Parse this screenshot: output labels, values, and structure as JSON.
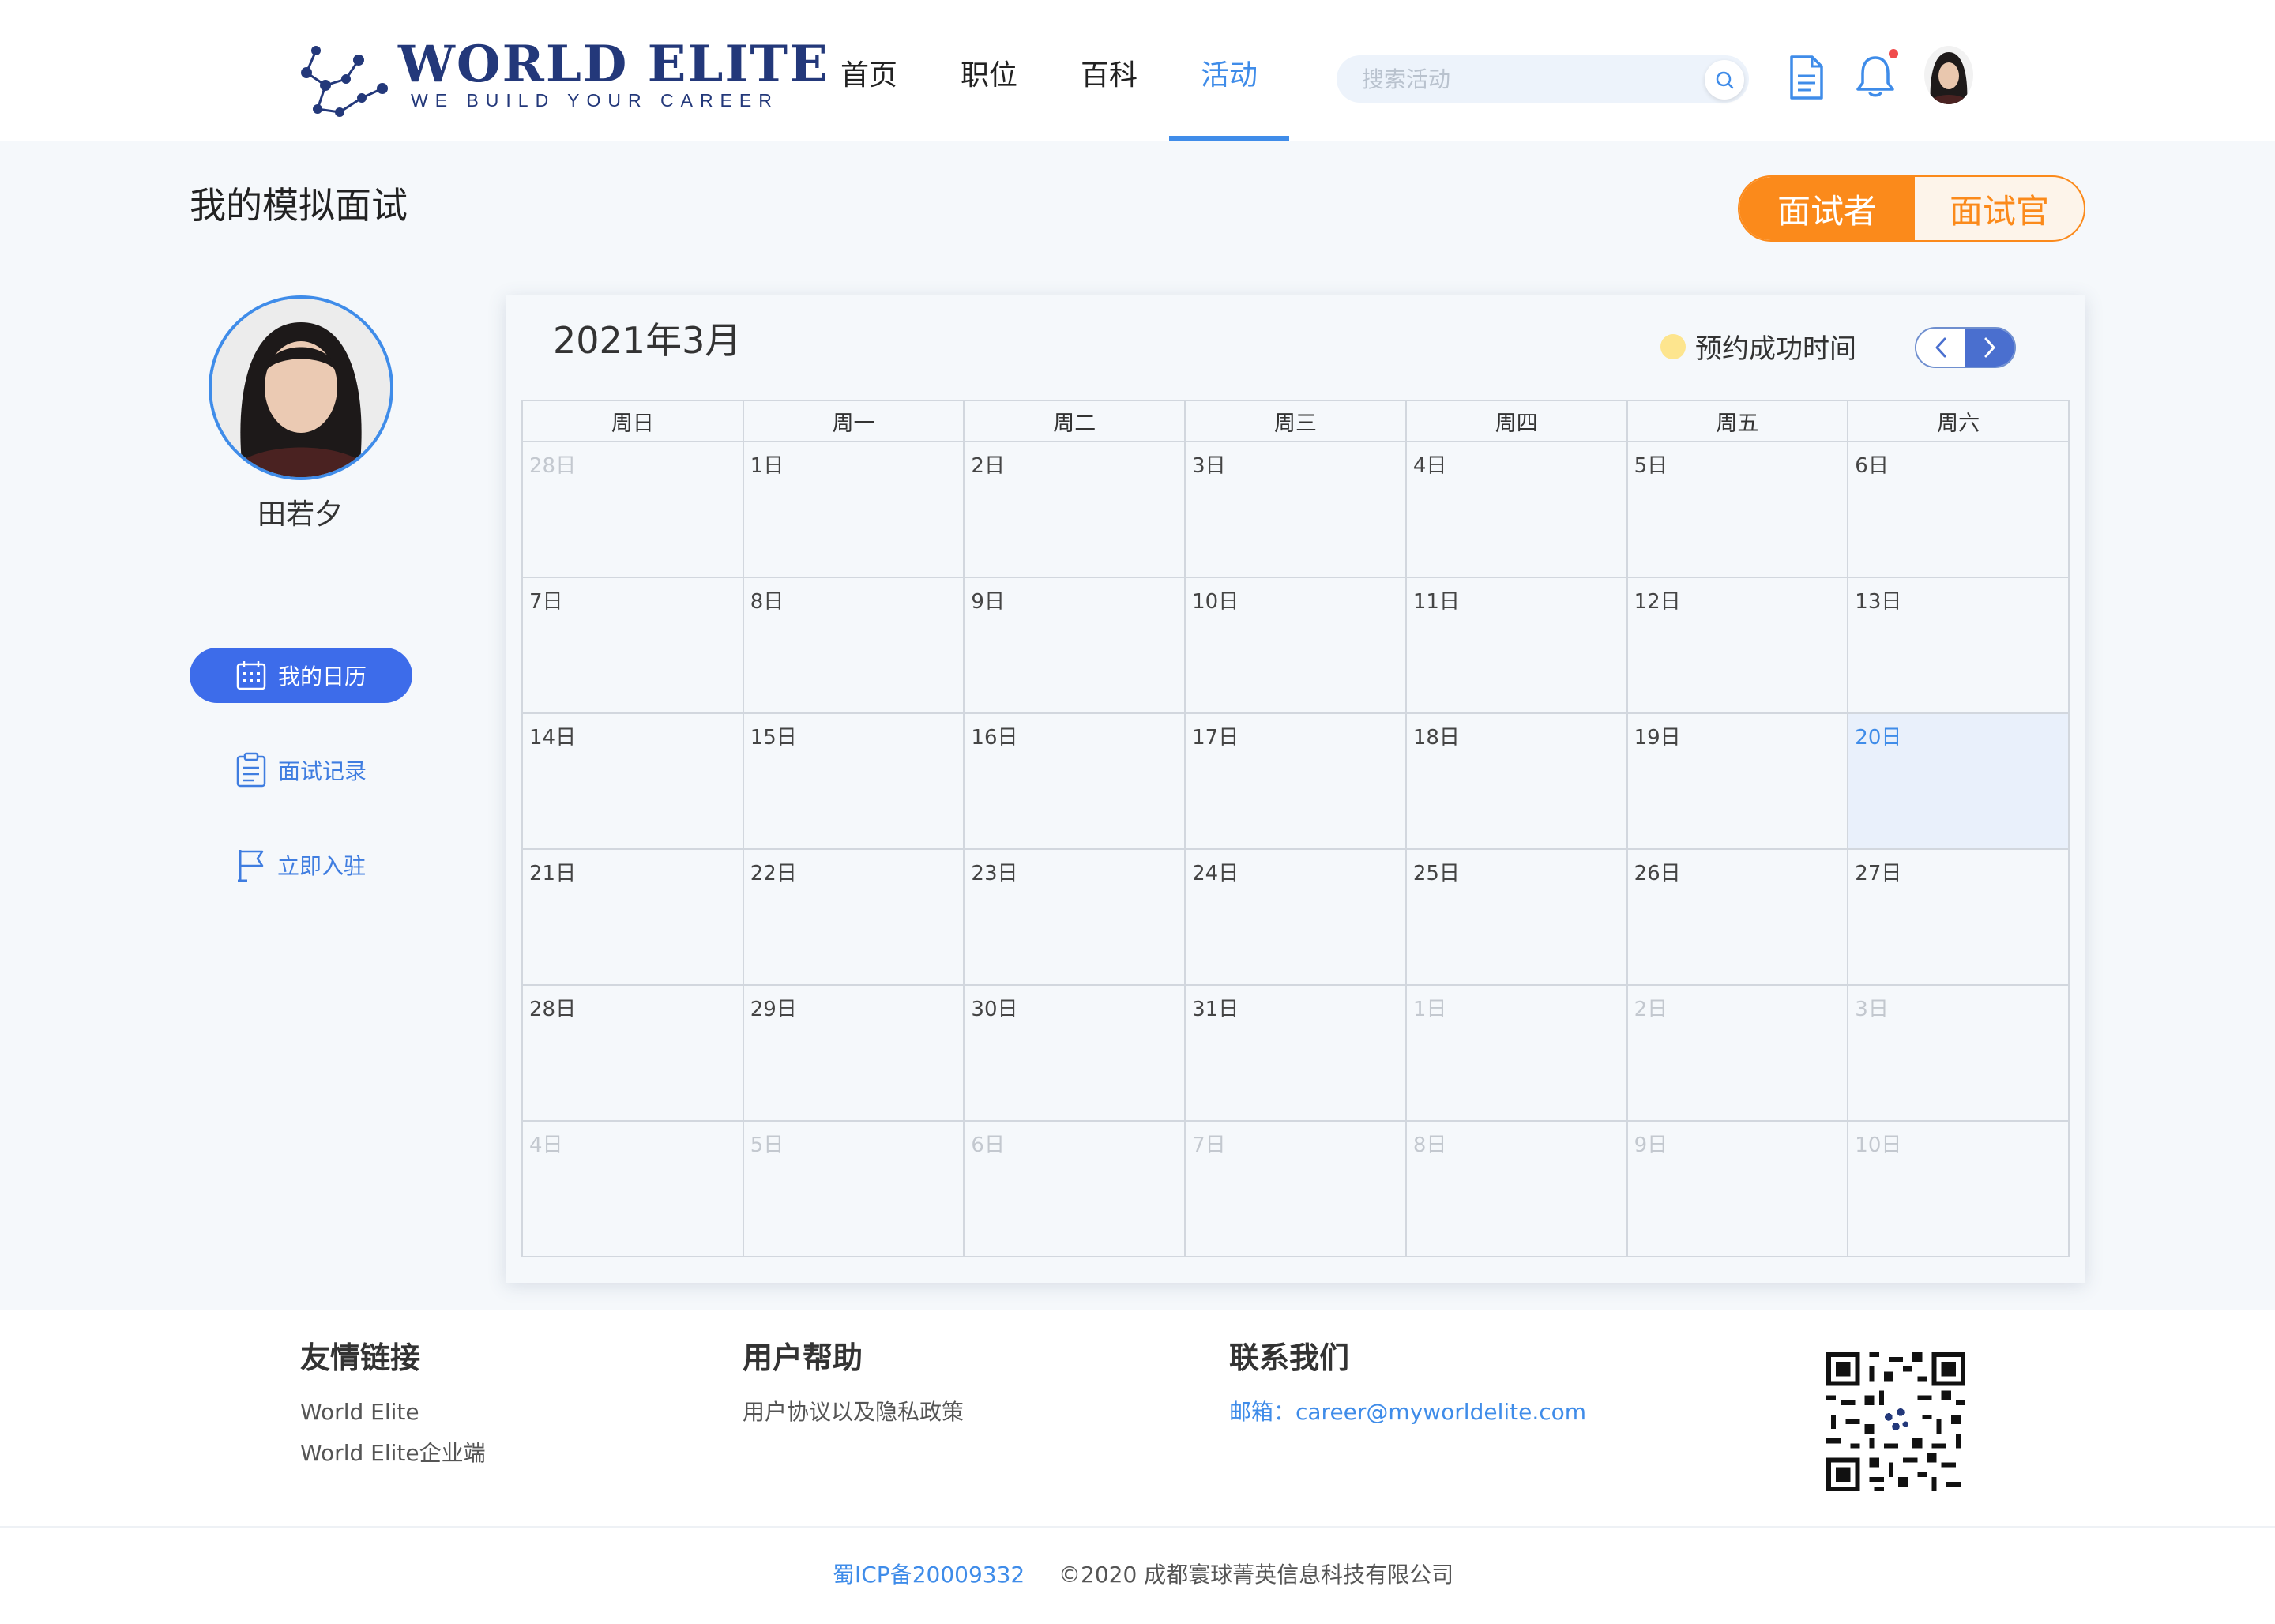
{
  "header": {
    "logo_title": "WORLD ELITE",
    "logo_tagline": "WE BUILD YOUR CAREER",
    "nav": [
      {
        "label": "首页"
      },
      {
        "label": "职位"
      },
      {
        "label": "百科"
      },
      {
        "label": "活动"
      }
    ],
    "active_nav": "活动",
    "search_placeholder": "搜索活动",
    "icons": [
      "document-icon",
      "bell-icon",
      "search-icon"
    ],
    "notification_dot": true
  },
  "page": {
    "title": "我的模拟面试",
    "roles": {
      "active": "面试者",
      "inactive": "面试官"
    }
  },
  "sidebar": {
    "user_name": "田若夕",
    "menu": [
      {
        "label": "我的日历",
        "icon": "calendar-icon",
        "active": true
      },
      {
        "label": "面试记录",
        "icon": "clipboard-icon",
        "active": false
      },
      {
        "label": "立即入驻",
        "icon": "flag-icon",
        "active": false
      }
    ]
  },
  "calendar": {
    "month_label": "2021年3月",
    "legend_label": "预约成功时间",
    "weekdays": [
      "周日",
      "周一",
      "周二",
      "周三",
      "周四",
      "周五",
      "周六"
    ],
    "weeks": [
      [
        {
          "d": "28日",
          "dim": true
        },
        {
          "d": "1日"
        },
        {
          "d": "2日"
        },
        {
          "d": "3日"
        },
        {
          "d": "4日"
        },
        {
          "d": "5日"
        },
        {
          "d": "6日"
        }
      ],
      [
        {
          "d": "7日"
        },
        {
          "d": "8日"
        },
        {
          "d": "9日"
        },
        {
          "d": "10日"
        },
        {
          "d": "11日"
        },
        {
          "d": "12日"
        },
        {
          "d": "13日"
        }
      ],
      [
        {
          "d": "14日"
        },
        {
          "d": "15日"
        },
        {
          "d": "16日"
        },
        {
          "d": "17日"
        },
        {
          "d": "18日"
        },
        {
          "d": "19日"
        },
        {
          "d": "20日",
          "today": true
        }
      ],
      [
        {
          "d": "21日"
        },
        {
          "d": "22日"
        },
        {
          "d": "23日"
        },
        {
          "d": "24日"
        },
        {
          "d": "25日"
        },
        {
          "d": "26日"
        },
        {
          "d": "27日"
        }
      ],
      [
        {
          "d": "28日"
        },
        {
          "d": "29日"
        },
        {
          "d": "30日"
        },
        {
          "d": "31日"
        },
        {
          "d": "1日",
          "dim": true
        },
        {
          "d": "2日",
          "dim": true
        },
        {
          "d": "3日",
          "dim": true
        }
      ],
      [
        {
          "d": "4日",
          "dim": true
        },
        {
          "d": "5日",
          "dim": true
        },
        {
          "d": "6日",
          "dim": true
        },
        {
          "d": "7日",
          "dim": true
        },
        {
          "d": "8日",
          "dim": true
        },
        {
          "d": "9日",
          "dim": true
        },
        {
          "d": "10日",
          "dim": true
        }
      ]
    ]
  },
  "footer": {
    "friend_links": {
      "title": "友情链接",
      "items": [
        "World Elite",
        "World Elite企业端"
      ]
    },
    "help": {
      "title": "用户帮助",
      "items": [
        "用户协议以及隐私政策"
      ]
    },
    "contact": {
      "title": "联系我们",
      "email_line": "邮箱：career@myworldelite.com"
    },
    "icp": "蜀ICP备20009332",
    "copyright": "©2020 成都寰球菁英信息科技有限公司"
  },
  "colors": {
    "accent_blue": "#3f8ce9",
    "button_blue": "#3d6cea",
    "orange": "#fb8a1b",
    "legend_yellow": "#fde58e",
    "logo_navy": "#23387a"
  }
}
